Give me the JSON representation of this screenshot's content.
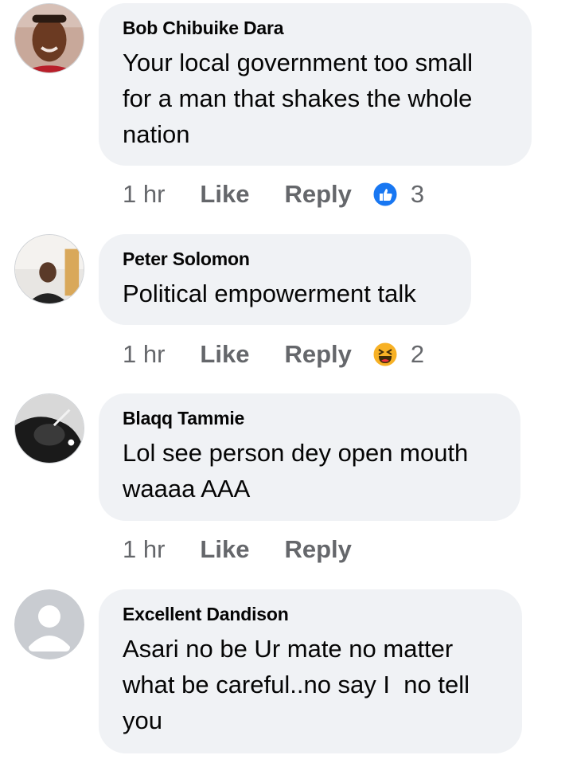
{
  "comments": [
    {
      "author": "Bob Chibuike Dara",
      "text": "Your local government too small for a man that shakes the whole nation",
      "time": "1 hr",
      "like_label": "Like",
      "reply_label": "Reply",
      "reaction": "like-reaction-icon",
      "reaction_count": "3",
      "avatar": "profile-photo-avatar"
    },
    {
      "author": "Peter Solomon",
      "text": "Political empowerment talk",
      "time": "1 hr",
      "like_label": "Like",
      "reply_label": "Reply",
      "reaction": "haha-reaction-icon",
      "reaction_count": "2",
      "avatar": "profile-photo-avatar"
    },
    {
      "author": "Blaqq Tammie",
      "text": "Lol see person dey open mouth waaaa AAA",
      "time": "1 hr",
      "like_label": "Like",
      "reply_label": "Reply",
      "avatar": "profile-photo-avatar"
    },
    {
      "author": "Excellent Dandison",
      "text": "Asari no be Ur mate no matter what be careful..no say I  no tell you",
      "avatar": "default-avatar"
    }
  ],
  "colors": {
    "bubble": "#f0f2f5",
    "meta_text": "#65676b",
    "like_blue": "#1877f2",
    "haha_yellow": "#f7b125"
  }
}
